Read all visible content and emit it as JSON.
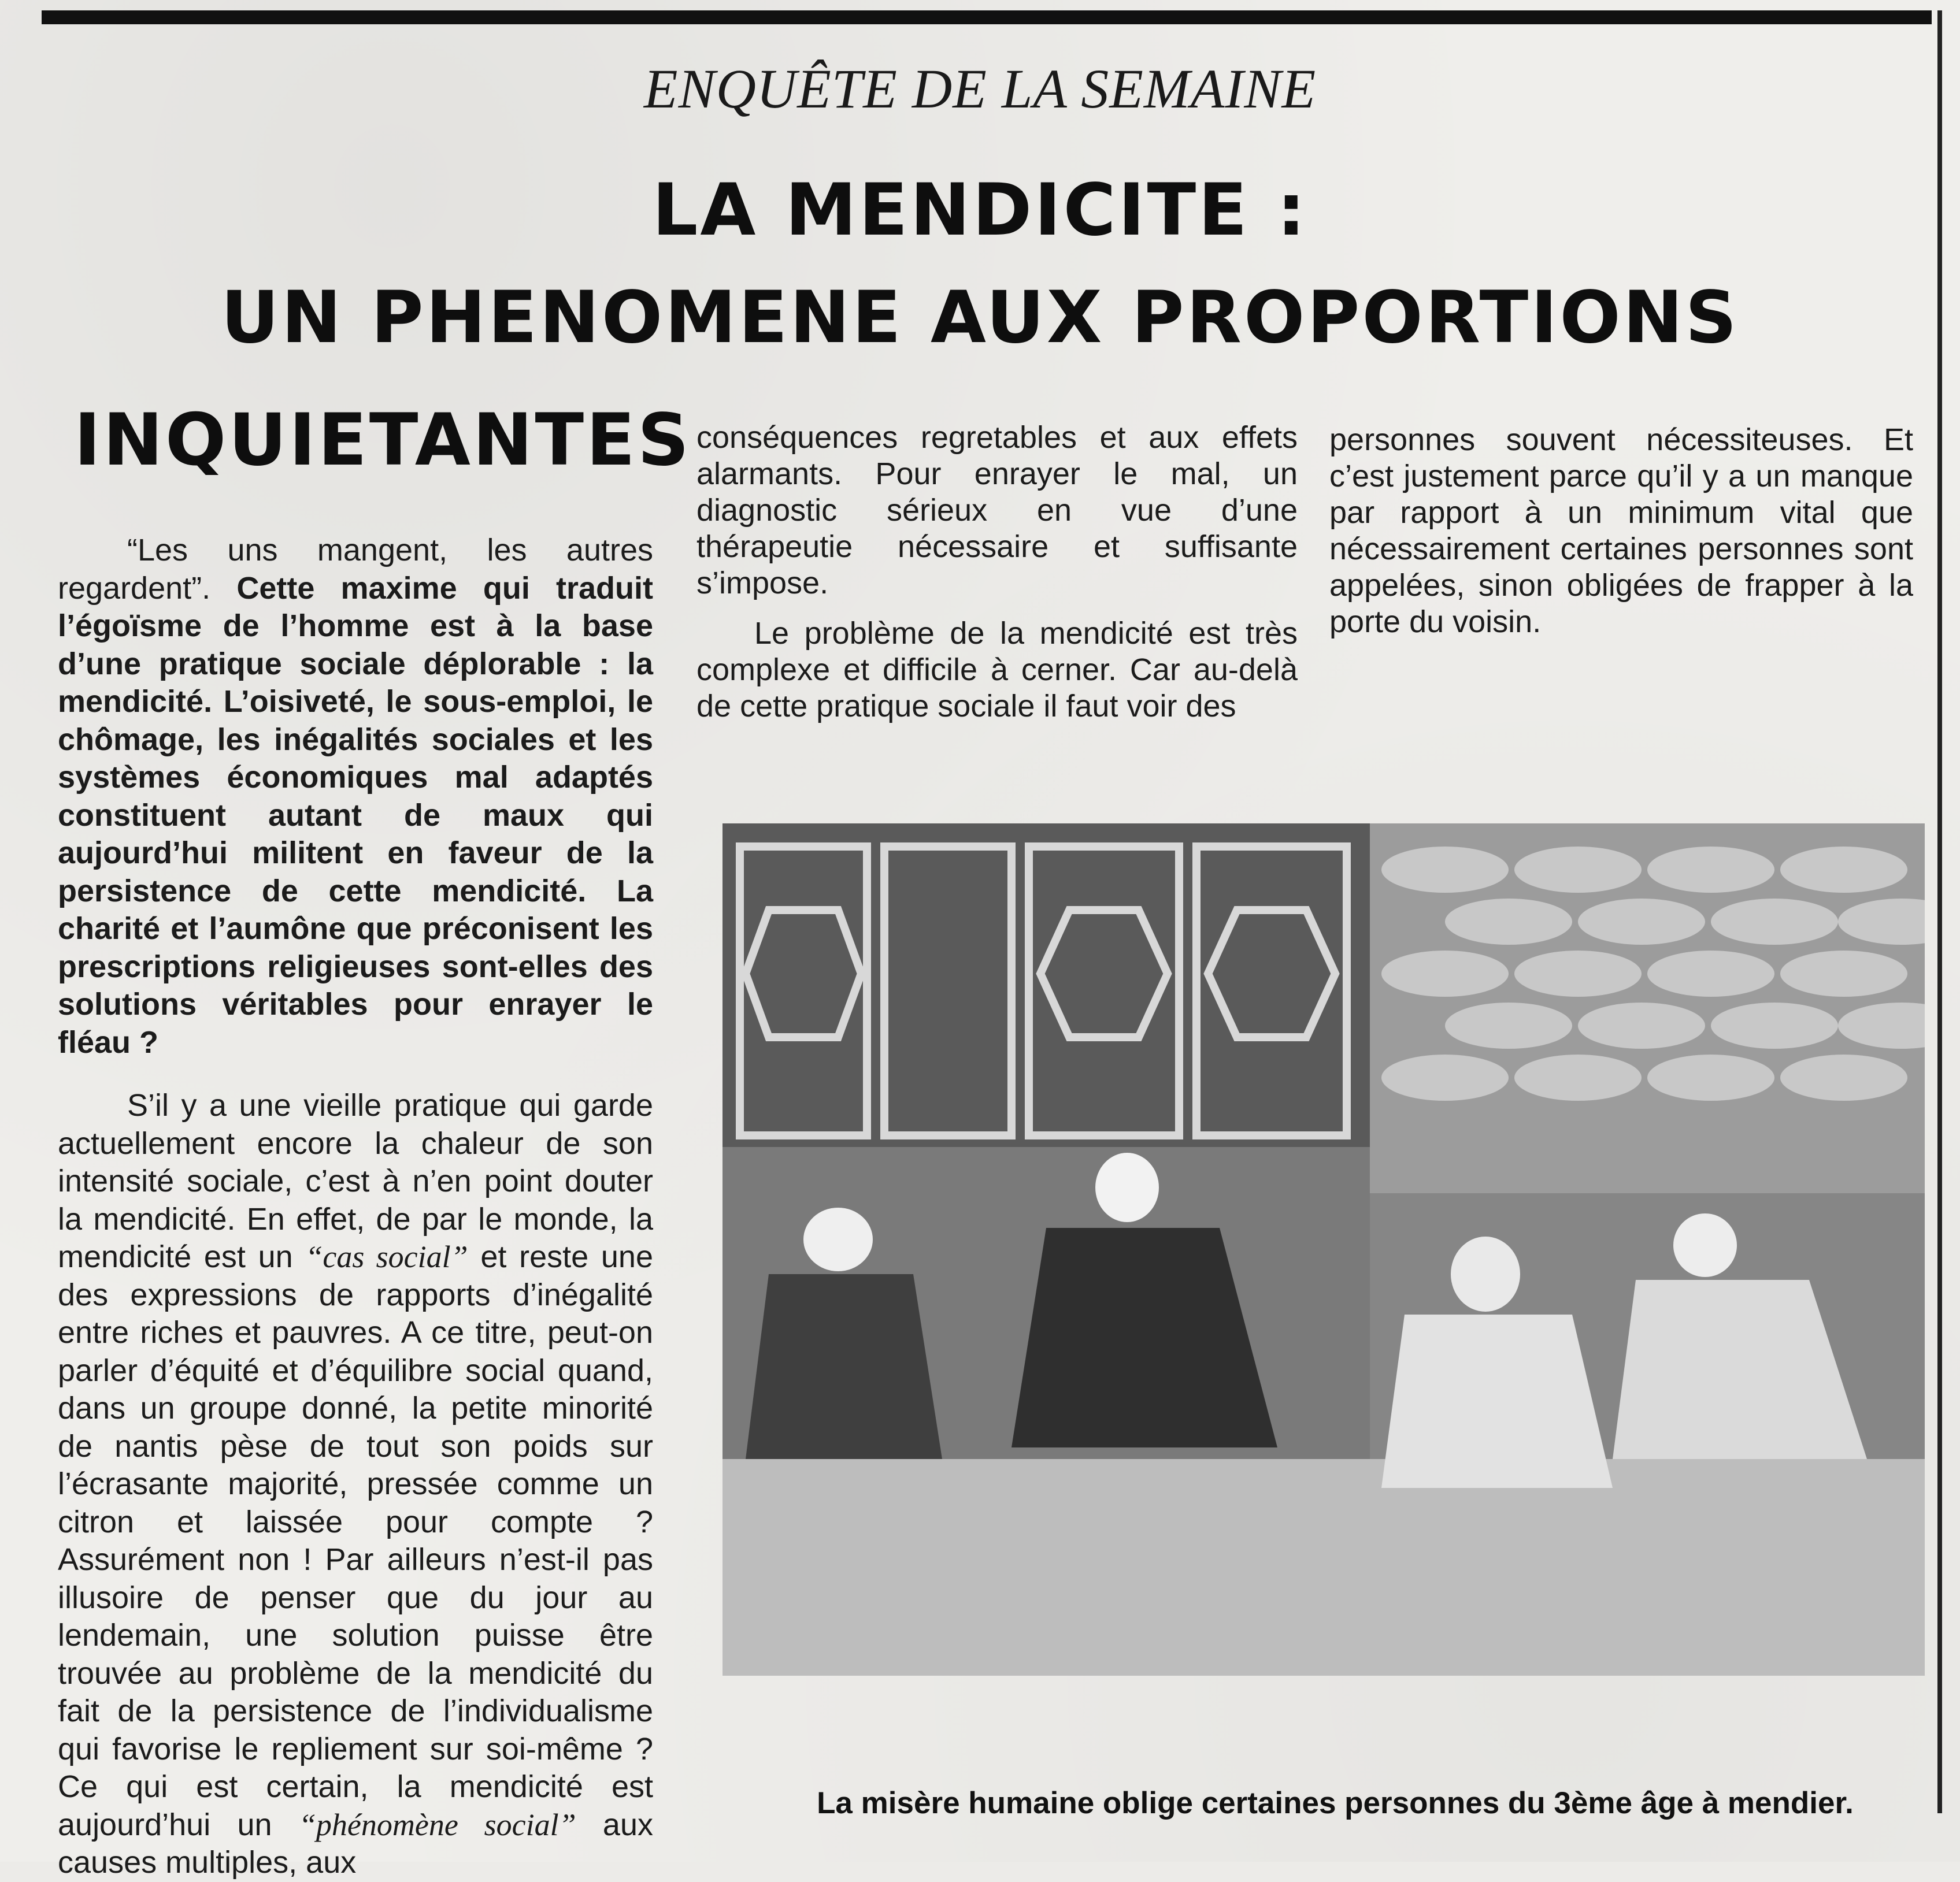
{
  "article": {
    "kicker": "ENQUÊTE DE LA SEMAINE",
    "headline_line1": "LA MENDICITE :",
    "headline_line2": "UN PHENOMENE AUX PROPORTIONS",
    "headline_line3": "INQUIETANTES"
  },
  "col1": {
    "lead_quote": "“Les uns mangent, les autres regardent”.",
    "lead_bold": " Cette maxime qui traduit l’égoïsme de l’homme est à la base d’une pratique sociale déplorable : la mendicité. L’oisiveté, le sous-emploi, le chômage, les inégalités sociales et les systèmes économiques mal adaptés constituent autant de maux qui aujourd’hui militent en faveur de la persistence de cette mendicité. La charité et l’aumône que préconisent les prescriptions religieuses sont-elles des solutions véritables pour enrayer le fléau ?",
    "p2_a": "S’il y a une vieille pratique qui garde actuellement encore la chaleur de son intensité sociale, c’est à n’en point douter la mendicité. En effet, de par le monde, la mendicité est un ",
    "p2_em1": "“cas social”",
    "p2_b": " et reste une des expressions de rapports d’inégalité entre riches et pauvres. A ce titre, peut-on parler d’équité et d’équilibre social quand, dans un groupe donné, la petite minorité de nantis pèse de tout son poids sur l’écrasante majorité, pressée comme un citron et laissée pour compte ? Assurément non ! Par ailleurs n’est-il pas illusoire de penser que du jour au lendemain, une solution puisse être trouvée au problème de la mendicité du fait de la persistence de l’individualisme qui favorise le repliement sur soi-même ? Ce qui est certain, la mendicité est aujourd’hui un ",
    "p2_em2": "“phénomène social”",
    "p2_c": " aux causes multiples, aux"
  },
  "col2": {
    "p1": "conséquences regretables et aux effets alarmants. Pour enrayer le mal, un diagnostic sérieux en vue d’une thérapeutie nécessaire et suffisante s’impose.",
    "p2": "Le problème de la mendicité est très complexe et difficile à cerner. Car au-delà de cette pratique sociale il faut voir des"
  },
  "col3": {
    "p1": "personnes souvent nécessiteuses. Et c’est justement parce qu’il y a un manque par rapport à un minimum vital que nécessairement certaines personnes sont appelées, sinon obligées de frapper à la porte du voisin."
  },
  "photo": {
    "caption": "La misère humaine oblige certaines personnes du 3ème âge à mendier."
  }
}
